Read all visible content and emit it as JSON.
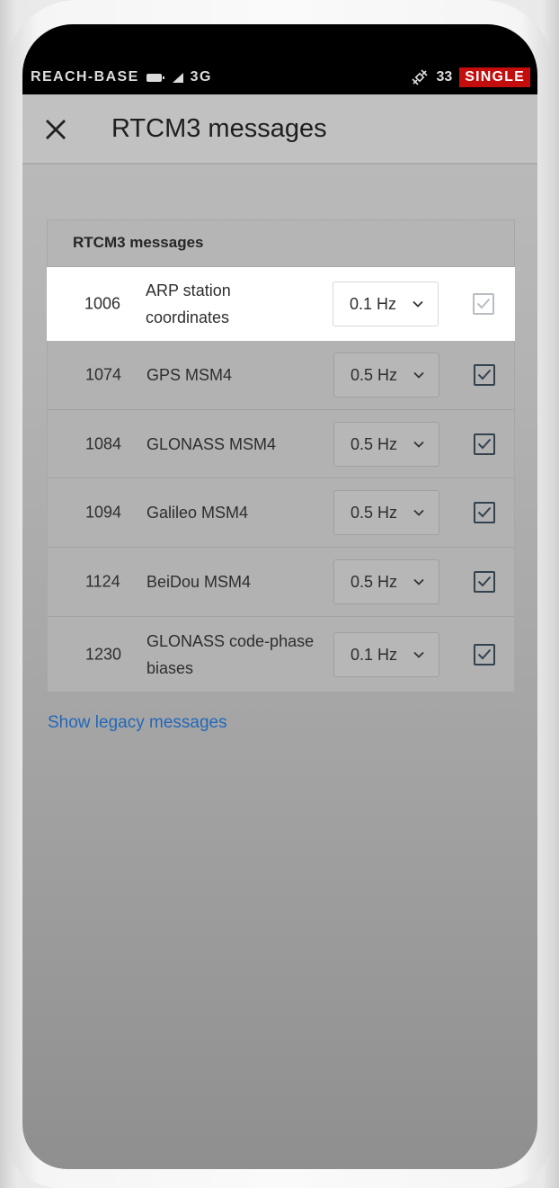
{
  "status_bar": {
    "device_name": "REACH-BASE",
    "network": "3G",
    "satellites": "33",
    "solution": "SINGLE"
  },
  "header": {
    "title": "RTCM3 messages"
  },
  "card": {
    "title": "RTCM3 messages",
    "rows": [
      {
        "id": "1006",
        "name": "ARP station coordinates",
        "rate": "0.1 Hz",
        "checked": true
      },
      {
        "id": "1074",
        "name": "GPS MSM4",
        "rate": "0.5 Hz",
        "checked": true
      },
      {
        "id": "1084",
        "name": "GLONASS MSM4",
        "rate": "0.5 Hz",
        "checked": true
      },
      {
        "id": "1094",
        "name": "Galileo MSM4",
        "rate": "0.5 Hz",
        "checked": true
      },
      {
        "id": "1124",
        "name": "BeiDou MSM4",
        "rate": "0.5 Hz",
        "checked": true
      },
      {
        "id": "1230",
        "name": "GLONASS code-phase biases",
        "rate": "0.1 Hz",
        "checked": true
      }
    ]
  },
  "footer": {
    "legacy_link": "Show legacy messages"
  },
  "colors": {
    "solution_badge": "#c40d0d",
    "link": "#2268b8",
    "checkbox": "#34414f"
  },
  "icons": {
    "close": "close-icon",
    "dropdown": "chevron-down-icon",
    "checkbox": "check-icon",
    "battery": "battery-icon",
    "signal": "signal-icon",
    "satellite": "satellite-icon"
  }
}
